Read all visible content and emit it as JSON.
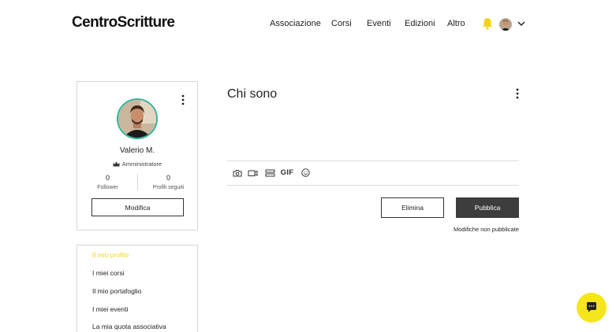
{
  "header": {
    "logo": "CentroScritture",
    "nav": [
      {
        "label": "Associazione"
      },
      {
        "label": "Corsi"
      },
      {
        "label": "Eventi"
      },
      {
        "label": "Edizioni"
      },
      {
        "label": "Altro"
      }
    ]
  },
  "profile": {
    "name": "Valerio M.",
    "role": "Amministratore",
    "followers_count": "0",
    "followers_label": "Follower",
    "following_count": "0",
    "following_label": "Profili seguiti",
    "edit_label": "Modifica"
  },
  "side_menu": {
    "items": [
      {
        "label": "Il mio profilo"
      },
      {
        "label": "I miei corsi"
      },
      {
        "label": "Il mio portafoglio"
      },
      {
        "label": "I miei eventi"
      },
      {
        "label": "La mia quota associativa"
      }
    ],
    "active": "Il mio profilo"
  },
  "about": {
    "title": "Chi sono",
    "gif_label": "GIF",
    "delete_label": "Elimina",
    "publish_label": "Pubblica",
    "status": "Modifiche non pubblicate"
  },
  "colors": {
    "accent_yellow": "#f2d312",
    "chat_yellow": "#f5e51c",
    "avatar_ring": "#32b39a",
    "publish_bg": "#3d3d3d",
    "border": "#d6d6d6"
  },
  "icons": [
    "bell-icon",
    "chevron-down-icon",
    "more-vertical-icon",
    "crown-icon",
    "camera-icon",
    "video-icon",
    "divider-icon",
    "emoji-icon",
    "chat-icon"
  ]
}
